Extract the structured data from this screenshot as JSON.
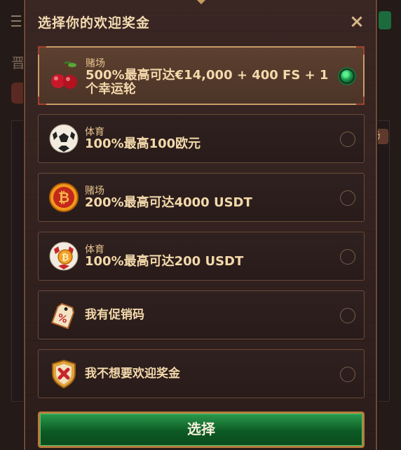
{
  "background": {
    "left_char": "晋",
    "right_tag": "场"
  },
  "modal": {
    "title": "选择你的欢迎奖金",
    "close_icon": "close-icon"
  },
  "options": [
    {
      "category": "赌场",
      "title": "500%最高可达€14,000 + 400 FS + 1个幸运轮",
      "icon": "cherry-icon",
      "selected": true
    },
    {
      "category": "体育",
      "title": "100%最高100欧元",
      "icon": "soccer-ball-icon",
      "selected": false
    },
    {
      "category": "赌场",
      "title": "200%最高可达4000 USDT",
      "icon": "bitcoin-coin-icon",
      "selected": false
    },
    {
      "category": "体育",
      "title": "100%最高可达200 USDT",
      "icon": "bitcoin-ball-icon",
      "selected": false
    },
    {
      "category": "",
      "title": "我有促销码",
      "icon": "promo-tag-icon",
      "selected": false
    },
    {
      "category": "",
      "title": "我不想要欢迎奖金",
      "icon": "no-bonus-shield-icon",
      "selected": false
    }
  ],
  "select_button": "选择",
  "colors": {
    "accent_gold": "#c89d67",
    "selected_radio": "#1fa151",
    "button_green": "#0d5a24"
  }
}
